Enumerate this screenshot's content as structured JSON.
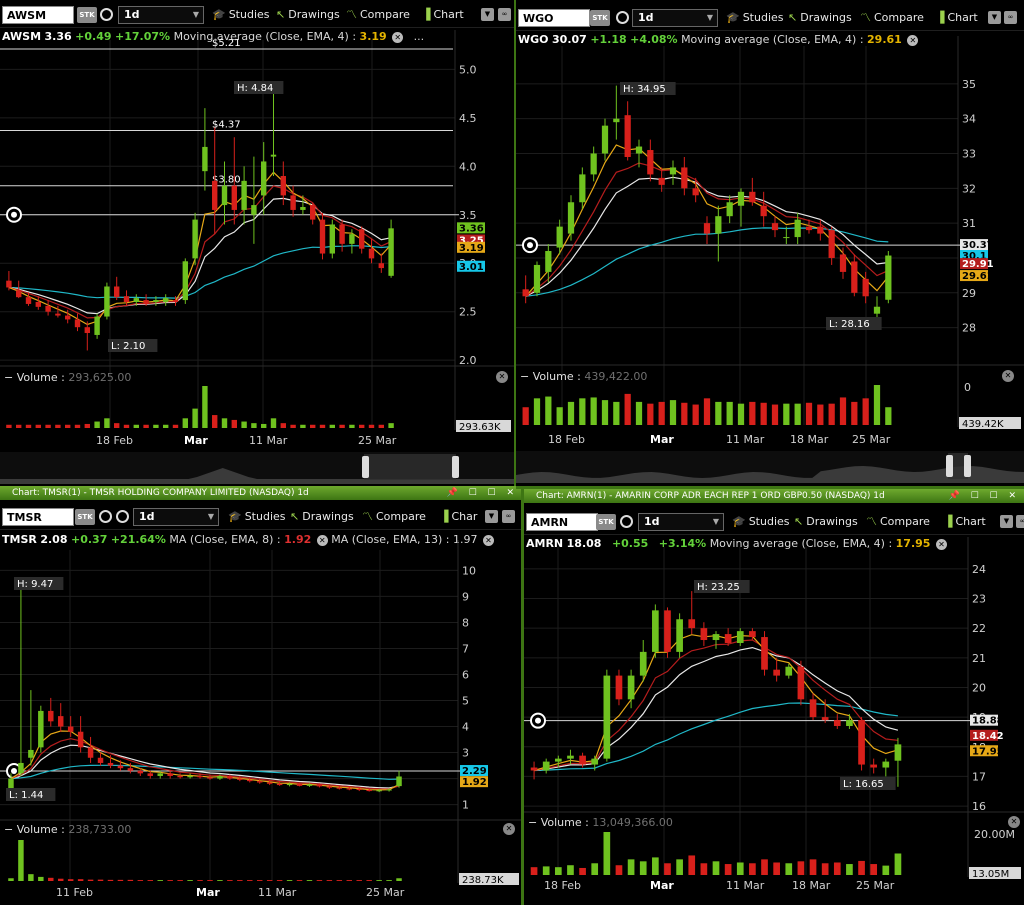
{
  "colors": {
    "up": "#6fc21f",
    "down": "#d8201b",
    "ema4": "#e6a817",
    "ema_red": "#b51d1d",
    "ema_white": "#e8e8e8",
    "ema_cyan": "#20b8c8",
    "accent_green": "#6ea92e"
  },
  "toolbar_labels": {
    "timeframe": "1d",
    "studies": "Studies",
    "drawings": "Drawings",
    "compare": "Compare",
    "chart": "Chart",
    "stk": "STK"
  },
  "panels": [
    {
      "id": "awsm",
      "title_bar": "",
      "symbol": "AWSM",
      "chart_label": "Chart",
      "quote": {
        "sym": "AWSM",
        "last": "3.36",
        "change": "+0.49",
        "pct": "+17.07%",
        "ma_label": "Moving average (Close, EMA, 4) :",
        "ma_value": "3.19",
        "ma_label2": "",
        "ma_value2": ""
      },
      "y_ticks": [
        "5.0",
        "4.5",
        "4.0",
        "3.5",
        "3.0",
        "2.5",
        "2.0"
      ],
      "price_lines": [
        "$5.21",
        "$4.37",
        "$3.80"
      ],
      "hi_label": "H: 4.84",
      "lo_label": "L: 2.10",
      "tags": [
        "3.36",
        "3.25",
        "3.19",
        "3.01"
      ],
      "volume_label": "Volume :",
      "volume_value": "293,625.00",
      "volume_tag": "293.63K",
      "volume_max": "",
      "dates": [
        "18 Feb",
        "Mar",
        "11 Mar",
        "25 Mar"
      ]
    },
    {
      "id": "wgo",
      "title_bar": "",
      "symbol": "WGO",
      "chart_label": "Chart",
      "quote": {
        "sym": "WGO",
        "last": "30.07",
        "change": "+1.18",
        "pct": "+4.08%",
        "ma_label": "Moving average (Close, EMA, 4) :",
        "ma_value": "29.61",
        "ma_label2": "",
        "ma_value2": ""
      },
      "y_ticks": [
        "35",
        "34",
        "33",
        "32",
        "31",
        "30",
        "29",
        "28"
      ],
      "price_lines": [],
      "hi_label": "H: 34.95",
      "lo_label": "L: 28.16",
      "tags": [
        "30.37",
        "30.1",
        "29.91",
        "29.61"
      ],
      "volume_label": "Volume :",
      "volume_value": "439,422.00",
      "volume_tag": "439.42K",
      "volume_max": "0",
      "dates": [
        "18 Feb",
        "Mar",
        "11 Mar",
        "18 Mar",
        "25 Mar"
      ]
    },
    {
      "id": "tmsr",
      "title_bar": "Chart: TMSR(1) - TMSR HOLDING COMPANY LIMITED (NASDAQ) 1d",
      "symbol": "TMSR",
      "chart_label": "Char",
      "quote": {
        "sym": "TMSR",
        "last": "2.08",
        "change": "+0.37",
        "pct": "+21.64%",
        "ma_label": "MA (Close, EMA, 8) :",
        "ma_value": "1.92",
        "ma_label2": "MA (Close, EMA, 13) :",
        "ma_value2": "1.97"
      },
      "y_ticks": [
        "10",
        "9",
        "8",
        "7",
        "6",
        "5",
        "4",
        "3",
        "2",
        "1"
      ],
      "price_lines": [],
      "hi_label": "H: 9.47",
      "lo_label": "L: 1.44",
      "tags": [
        "2.29",
        "1.92"
      ],
      "volume_label": "Volume :",
      "volume_value": "238,733.00",
      "volume_tag": "238.73K",
      "volume_max": "",
      "dates": [
        "11 Feb",
        "Mar",
        "11 Mar",
        "25 Mar"
      ]
    },
    {
      "id": "amrn",
      "title_bar": "Chart: AMRN(1) - AMARIN CORP ADR EACH REP 1 ORD GBP0.50 (NASDAQ) 1d",
      "symbol": "AMRN",
      "chart_label": "Chart",
      "quote": {
        "sym": "AMRN",
        "last": "18.08",
        "change": "+0.55",
        "pct": "+3.14%",
        "ma_label": "Moving average (Close, EMA, 4) :",
        "ma_value": "17.95",
        "ma_label2": "",
        "ma_value2": ""
      },
      "y_ticks": [
        "24",
        "23",
        "22",
        "21",
        "20",
        "19",
        "18",
        "17",
        "16"
      ],
      "price_lines": [],
      "hi_label": "H: 23.25",
      "lo_label": "L: 16.65",
      "tags": [
        "18.88",
        "18.42",
        "17.95"
      ],
      "volume_label": "Volume :",
      "volume_value": "13,049,366.00",
      "volume_tag": "13.05M",
      "volume_max": "20.00M",
      "dates": [
        "18 Feb",
        "Mar",
        "11 Mar",
        "18 Mar",
        "25 Mar"
      ]
    }
  ],
  "chart_data": [
    {
      "type": "candlestick",
      "title": "AWSM",
      "ylim": [
        1.95,
        5.2
      ],
      "candles": [
        [
          2.82,
          2.92,
          2.72,
          2.75
        ],
        [
          2.72,
          2.82,
          2.64,
          2.65
        ],
        [
          2.65,
          2.7,
          2.56,
          2.58
        ],
        [
          2.6,
          2.66,
          2.52,
          2.55
        ],
        [
          2.56,
          2.62,
          2.46,
          2.5
        ],
        [
          2.48,
          2.56,
          2.44,
          2.46
        ],
        [
          2.46,
          2.52,
          2.38,
          2.42
        ],
        [
          2.42,
          2.48,
          2.3,
          2.34
        ],
        [
          2.34,
          2.4,
          2.1,
          2.28
        ],
        [
          2.26,
          2.48,
          2.22,
          2.45
        ],
        [
          2.45,
          2.8,
          2.42,
          2.76
        ],
        [
          2.76,
          2.86,
          2.62,
          2.65
        ],
        [
          2.66,
          2.72,
          2.56,
          2.6
        ],
        [
          2.6,
          2.68,
          2.56,
          2.64
        ],
        [
          2.62,
          2.68,
          2.56,
          2.58
        ],
        [
          2.6,
          2.66,
          2.56,
          2.62
        ],
        [
          2.6,
          2.68,
          2.56,
          2.64
        ],
        [
          2.62,
          2.66,
          2.56,
          2.6
        ],
        [
          2.62,
          3.05,
          2.58,
          3.02
        ],
        [
          3.05,
          3.52,
          2.98,
          3.45
        ],
        [
          3.95,
          4.6,
          3.75,
          4.2
        ],
        [
          3.85,
          4.4,
          3.3,
          3.55
        ],
        [
          3.6,
          4.05,
          3.4,
          3.8
        ],
        [
          3.8,
          4.3,
          3.4,
          3.55
        ],
        [
          3.55,
          4.0,
          3.4,
          3.85
        ],
        [
          3.5,
          4.1,
          3.2,
          3.6
        ],
        [
          3.7,
          4.25,
          3.5,
          4.05
        ],
        [
          4.1,
          4.84,
          3.9,
          4.12
        ],
        [
          3.9,
          4.05,
          3.6,
          3.7
        ],
        [
          3.7,
          3.8,
          3.48,
          3.55
        ],
        [
          3.55,
          3.7,
          3.5,
          3.58
        ],
        [
          3.6,
          3.62,
          3.4,
          3.45
        ],
        [
          3.45,
          3.52,
          3.04,
          3.1
        ],
        [
          3.1,
          3.45,
          3.05,
          3.4
        ],
        [
          3.4,
          3.45,
          3.12,
          3.2
        ],
        [
          3.2,
          3.35,
          3.1,
          3.3
        ],
        [
          3.35,
          3.38,
          3.1,
          3.15
        ],
        [
          3.15,
          3.25,
          3.0,
          3.05
        ],
        [
          3.0,
          3.1,
          2.9,
          2.95
        ],
        [
          2.87,
          3.45,
          2.85,
          3.36
        ]
      ],
      "volume": [
        20,
        20,
        20,
        20,
        20,
        20,
        20,
        20,
        25,
        40,
        60,
        30,
        20,
        20,
        20,
        20,
        20,
        20,
        60,
        120,
        260,
        80,
        60,
        50,
        40,
        30,
        25,
        60,
        30,
        20,
        20,
        20,
        20,
        20,
        20,
        20,
        20,
        20,
        20,
        30
      ]
    },
    {
      "type": "candlestick",
      "title": "WGO",
      "ylim": [
        27.3,
        35.8
      ],
      "candles": [
        [
          29.1,
          29.5,
          28.7,
          28.9
        ],
        [
          29.0,
          29.9,
          28.9,
          29.8
        ],
        [
          29.6,
          30.4,
          29.3,
          30.2
        ],
        [
          30.3,
          31.1,
          30.1,
          30.9
        ],
        [
          30.7,
          31.8,
          30.5,
          31.6
        ],
        [
          31.6,
          32.6,
          31.4,
          32.4
        ],
        [
          32.4,
          33.2,
          32.2,
          33.0
        ],
        [
          33.0,
          34.0,
          32.8,
          33.8
        ],
        [
          33.9,
          34.95,
          33.4,
          34.0
        ],
        [
          34.1,
          34.5,
          32.8,
          32.9
        ],
        [
          33.0,
          33.4,
          32.6,
          33.2
        ],
        [
          33.1,
          33.4,
          32.2,
          32.4
        ],
        [
          32.3,
          32.6,
          31.9,
          32.1
        ],
        [
          32.4,
          32.8,
          32.1,
          32.6
        ],
        [
          32.6,
          32.9,
          31.8,
          32.0
        ],
        [
          32.0,
          32.3,
          31.6,
          31.8
        ],
        [
          31.0,
          31.2,
          30.4,
          30.7
        ],
        [
          30.7,
          31.5,
          29.9,
          31.2
        ],
        [
          31.2,
          31.8,
          31.0,
          31.6
        ],
        [
          31.5,
          32.0,
          30.9,
          31.9
        ],
        [
          31.9,
          32.3,
          31.5,
          31.6
        ],
        [
          31.5,
          31.9,
          30.9,
          31.2
        ],
        [
          31.0,
          31.2,
          30.6,
          30.8
        ],
        [
          30.6,
          30.9,
          30.4,
          30.6
        ],
        [
          30.6,
          31.3,
          30.4,
          31.1
        ],
        [
          30.9,
          31.1,
          30.7,
          30.8
        ],
        [
          30.9,
          31.1,
          30.5,
          30.7
        ],
        [
          30.8,
          30.9,
          29.8,
          30.0
        ],
        [
          30.1,
          30.3,
          29.4,
          29.6
        ],
        [
          29.9,
          30.1,
          28.9,
          29.0
        ],
        [
          29.4,
          29.6,
          28.7,
          28.9
        ],
        [
          28.4,
          28.9,
          28.16,
          28.6
        ],
        [
          28.8,
          30.2,
          28.7,
          30.07
        ]
      ],
      "volume": [
        200,
        300,
        320,
        200,
        260,
        300,
        310,
        280,
        260,
        350,
        260,
        240,
        260,
        280,
        250,
        230,
        300,
        260,
        260,
        240,
        260,
        250,
        230,
        240,
        240,
        250,
        230,
        240,
        310,
        260,
        300,
        450,
        200
      ]
    },
    {
      "type": "candlestick",
      "title": "TMSR",
      "ylim": [
        0.6,
        10.4
      ],
      "candles": [
        [
          1.6,
          2.2,
          1.44,
          2.0
        ],
        [
          2.2,
          9.47,
          2.1,
          2.6
        ],
        [
          2.8,
          5.4,
          2.5,
          3.1
        ],
        [
          3.2,
          4.8,
          3.0,
          4.6
        ],
        [
          4.6,
          5.1,
          4.0,
          4.2
        ],
        [
          4.4,
          4.9,
          3.8,
          4.0
        ],
        [
          4.0,
          4.4,
          3.6,
          3.8
        ],
        [
          3.8,
          4.4,
          3.0,
          3.2
        ],
        [
          3.2,
          3.6,
          2.6,
          2.8
        ],
        [
          2.8,
          3.0,
          2.5,
          2.6
        ],
        [
          2.6,
          2.9,
          2.4,
          2.5
        ],
        [
          2.5,
          2.7,
          2.3,
          2.4
        ],
        [
          2.4,
          2.6,
          2.2,
          2.3
        ],
        [
          2.3,
          2.4,
          2.1,
          2.2
        ],
        [
          2.2,
          2.3,
          2.0,
          2.1
        ],
        [
          2.1,
          2.3,
          2.0,
          2.2
        ],
        [
          2.2,
          2.3,
          2.0,
          2.1
        ],
        [
          2.1,
          2.2,
          2.0,
          2.05
        ],
        [
          2.05,
          2.2,
          2.0,
          2.1
        ],
        [
          2.1,
          2.2,
          2.0,
          2.05
        ],
        [
          2.05,
          2.15,
          1.95,
          2.0
        ],
        [
          2.0,
          2.15,
          1.95,
          2.1
        ],
        [
          2.1,
          2.15,
          1.95,
          2.0
        ],
        [
          2.0,
          2.1,
          1.9,
          1.95
        ],
        [
          1.95,
          2.05,
          1.85,
          1.9
        ],
        [
          1.9,
          2.0,
          1.8,
          1.85
        ],
        [
          1.85,
          1.95,
          1.75,
          1.8
        ],
        [
          1.8,
          1.9,
          1.72,
          1.75
        ],
        [
          1.75,
          1.85,
          1.7,
          1.8
        ],
        [
          1.8,
          1.85,
          1.7,
          1.72
        ],
        [
          1.72,
          1.82,
          1.68,
          1.78
        ],
        [
          1.78,
          1.82,
          1.66,
          1.7
        ],
        [
          1.7,
          1.76,
          1.6,
          1.65
        ],
        [
          1.65,
          1.72,
          1.58,
          1.62
        ],
        [
          1.62,
          1.7,
          1.55,
          1.6
        ],
        [
          1.6,
          1.68,
          1.52,
          1.56
        ],
        [
          1.56,
          1.62,
          1.5,
          1.52
        ],
        [
          1.52,
          1.6,
          1.48,
          1.55
        ],
        [
          1.55,
          1.62,
          1.5,
          1.58
        ],
        [
          1.71,
          2.3,
          1.65,
          2.08
        ]
      ],
      "volume": [
        60,
        900,
        150,
        90,
        70,
        50,
        40,
        40,
        30,
        30,
        25,
        25,
        25,
        20,
        20,
        20,
        20,
        20,
        20,
        20,
        20,
        20,
        20,
        20,
        20,
        20,
        20,
        20,
        20,
        20,
        20,
        20,
        20,
        20,
        20,
        20,
        20,
        20,
        20,
        60
      ]
    },
    {
      "type": "candlestick",
      "title": "AMRN",
      "ylim": [
        15.8,
        24.4
      ],
      "candles": [
        [
          17.3,
          17.5,
          16.9,
          17.2
        ],
        [
          17.2,
          17.6,
          17.1,
          17.5
        ],
        [
          17.5,
          17.7,
          17.3,
          17.6
        ],
        [
          17.6,
          17.9,
          17.4,
          17.7
        ],
        [
          17.7,
          17.8,
          17.3,
          17.4
        ],
        [
          17.4,
          17.7,
          17.2,
          17.6
        ],
        [
          17.6,
          20.6,
          17.5,
          20.4
        ],
        [
          20.4,
          20.6,
          19.4,
          19.6
        ],
        [
          19.6,
          20.6,
          19.3,
          20.4
        ],
        [
          20.4,
          21.6,
          20.2,
          21.2
        ],
        [
          21.2,
          22.8,
          21.0,
          22.6
        ],
        [
          22.6,
          22.7,
          21.0,
          21.2
        ],
        [
          21.2,
          22.5,
          21.0,
          22.3
        ],
        [
          22.3,
          23.25,
          21.8,
          22.0
        ],
        [
          22.0,
          22.2,
          21.4,
          21.6
        ],
        [
          21.6,
          21.9,
          21.3,
          21.8
        ],
        [
          21.8,
          22.0,
          21.4,
          21.5
        ],
        [
          21.5,
          22.0,
          21.4,
          21.9
        ],
        [
          21.9,
          22.0,
          21.6,
          21.7
        ],
        [
          21.7,
          21.9,
          20.4,
          20.6
        ],
        [
          20.6,
          21.0,
          20.2,
          20.4
        ],
        [
          20.4,
          20.8,
          20.3,
          20.7
        ],
        [
          20.7,
          20.9,
          19.4,
          19.6
        ],
        [
          19.6,
          19.8,
          18.9,
          19.0
        ],
        [
          19.0,
          19.6,
          18.8,
          18.9
        ],
        [
          18.9,
          19.1,
          18.6,
          18.7
        ],
        [
          18.7,
          19.1,
          18.6,
          18.9
        ],
        [
          18.9,
          19.0,
          17.2,
          17.4
        ],
        [
          17.4,
          17.6,
          17.1,
          17.3
        ],
        [
          17.3,
          17.6,
          17.0,
          17.5
        ],
        [
          17.53,
          18.3,
          16.65,
          18.08
        ]
      ],
      "volume": [
        20,
        22,
        20,
        25,
        18,
        30,
        110,
        25,
        40,
        35,
        45,
        30,
        40,
        50,
        30,
        35,
        28,
        32,
        30,
        40,
        32,
        30,
        35,
        40,
        30,
        32,
        28,
        36,
        28,
        24,
        55
      ]
    }
  ]
}
